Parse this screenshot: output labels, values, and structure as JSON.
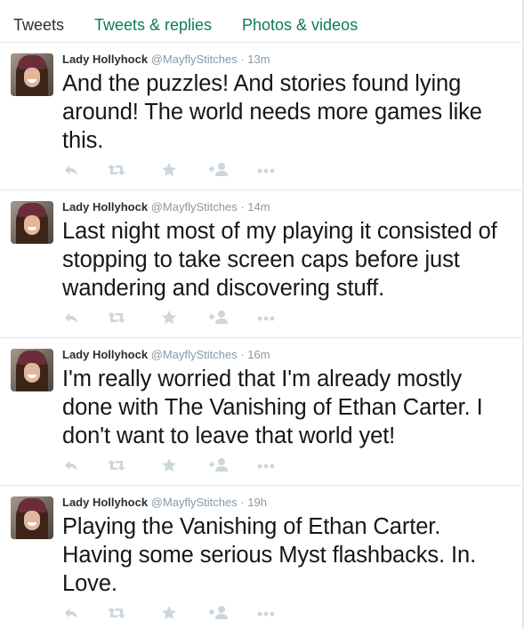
{
  "tabs": [
    {
      "label": "Tweets"
    },
    {
      "label": "Tweets & replies"
    },
    {
      "label": "Photos & videos"
    }
  ],
  "tweets": [
    {
      "name": "Lady Hollyhock",
      "handle": "@MayflyStitches",
      "separator": "·",
      "time": "13m",
      "text": "And the puzzles! And stories found lying around! The world needs more games like this."
    },
    {
      "name": "Lady Hollyhock",
      "handle": "@MayflyStitches",
      "separator": "·",
      "time": "14m",
      "text": "Last night most of my playing it consisted of stopping to take screen caps before just wandering and discovering stuff."
    },
    {
      "name": "Lady Hollyhock",
      "handle": "@MayflyStitches",
      "separator": "·",
      "time": "16m",
      "text": "I'm really worried that I'm already mostly done with The Vanishing of Ethan Carter. I don't want to leave that world yet!"
    },
    {
      "name": "Lady Hollyhock",
      "handle": "@MayflyStitches",
      "separator": "·",
      "time": "19h",
      "text": "Playing the Vanishing of Ethan Carter. Having some serious Myst flashbacks. In. Love."
    }
  ],
  "icons": {
    "reply": "reply-icon",
    "retweet": "retweet-icon",
    "favorite": "star-icon",
    "follow": "follow-icon",
    "more": "more-icon"
  },
  "colors": {
    "tab_active": "#292f33",
    "tab_link": "#0e7a5c",
    "muted": "#8899a6",
    "action_icon": "#ccd6dd",
    "divider": "#e1e8ed"
  }
}
